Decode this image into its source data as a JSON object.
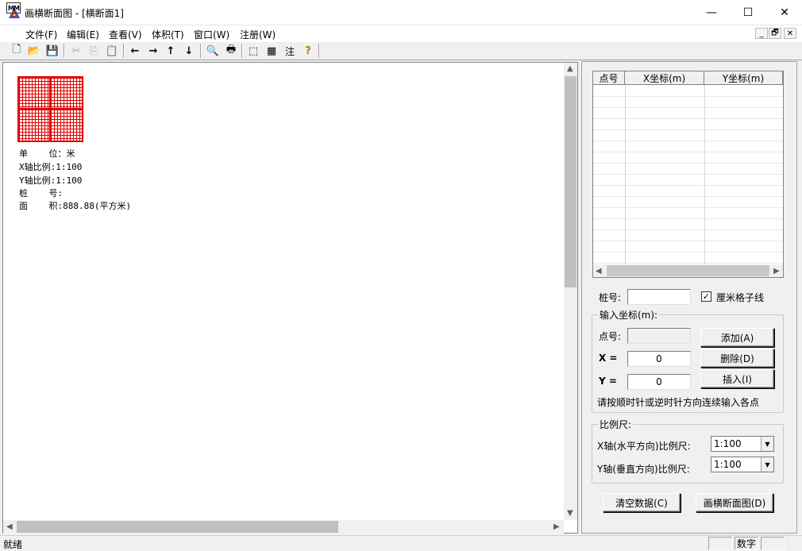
{
  "window": {
    "title": "画横断面图 - [横断面1]",
    "controls": {
      "minimize": "—",
      "maximize": "☐",
      "close": "✕"
    }
  },
  "menubar": {
    "icon_text": "MM",
    "items": [
      "文件(F)",
      "编辑(E)",
      "查看(V)",
      "体积(T)",
      "窗口(W)",
      "注册(W)"
    ],
    "mdi_controls": [
      "_",
      "🗗",
      "✕"
    ]
  },
  "toolbar": {
    "buttons": [
      {
        "name": "new-icon",
        "glyph": "🗋"
      },
      {
        "name": "open-icon",
        "glyph": "📂"
      },
      {
        "name": "save-icon",
        "glyph": "💾"
      },
      {
        "name": "cut-icon",
        "glyph": "✂"
      },
      {
        "name": "copy-icon",
        "glyph": "⎘"
      },
      {
        "name": "paste-icon",
        "glyph": "📋"
      },
      {
        "name": "arrow-left-icon",
        "glyph": "←"
      },
      {
        "name": "arrow-right-icon",
        "glyph": "→"
      },
      {
        "name": "arrow-up-icon",
        "glyph": "↑"
      },
      {
        "name": "arrow-down-icon",
        "glyph": "↓"
      },
      {
        "name": "print-preview-icon",
        "glyph": "🔍"
      },
      {
        "name": "print-icon",
        "glyph": "🖶"
      },
      {
        "name": "box-icon",
        "glyph": "⬚"
      },
      {
        "name": "grid-icon",
        "glyph": "▦"
      },
      {
        "name": "annotate-icon",
        "glyph": "注"
      },
      {
        "name": "help-icon",
        "glyph": "?"
      }
    ]
  },
  "drawing": {
    "info_lines": [
      "单    位：米",
      "X轴比例:1:100",
      "Y轴比例:1:100",
      "桩    号:",
      "面    积:888.88(平方米)"
    ],
    "grid_color": "#e00000"
  },
  "panel": {
    "table": {
      "headers": [
        "点号",
        "X坐标(m)",
        "Y坐标(m)"
      ],
      "rows": []
    },
    "station_label": "桩号:",
    "station_value": "",
    "cm_grid_label": "厘米格子线",
    "cm_grid_checked": true,
    "input_group": {
      "title": "输入坐标(m):",
      "point_label": "点号:",
      "point_value": "",
      "x_label": "X =",
      "x_value": "0",
      "y_label": "Y =",
      "y_value": "0",
      "add_button": "添加(A)",
      "delete_button": "删除(D)",
      "insert_button": "插入(I)",
      "hint": "请按顺时针或逆时针方向连续输入各点"
    },
    "scale_group": {
      "title": "比例尺:",
      "x_label": "X轴(水平方向)比例尺:",
      "x_value": "1:100",
      "y_label": "Y轴(垂直方向)比例尺:",
      "y_value": "1:100"
    },
    "clear_button": "清空数据(C)",
    "draw_button": "画横断面图(D)"
  },
  "statusbar": {
    "text": "就绪",
    "panes": [
      "",
      "数字",
      ""
    ]
  }
}
